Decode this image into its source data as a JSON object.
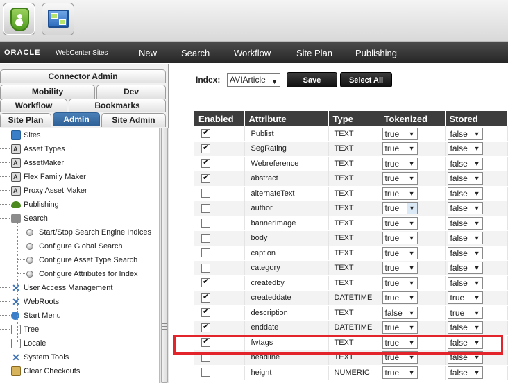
{
  "nav": {
    "logo": "ORACLE",
    "product": "WebCenter Sites",
    "items": [
      "New",
      "Search",
      "Workflow",
      "Site Plan",
      "Publishing"
    ]
  },
  "tabs": {
    "connector_admin": "Connector Admin",
    "mobility": "Mobility",
    "dev": "Dev",
    "workflow": "Workflow",
    "bookmarks": "Bookmarks",
    "site_plan": "Site Plan",
    "admin": "Admin",
    "site_admin": "Site Admin"
  },
  "tree": [
    {
      "label": "Sites",
      "icon": "sites-icon"
    },
    {
      "label": "Asset Types",
      "icon": "asset-icon"
    },
    {
      "label": "AssetMaker",
      "icon": "asset-icon"
    },
    {
      "label": "Flex Family Maker",
      "icon": "asset-icon"
    },
    {
      "label": "Proxy Asset Maker",
      "icon": "asset-icon"
    },
    {
      "label": "Publishing",
      "icon": "publishing-icon"
    },
    {
      "label": "Search",
      "icon": "search-folder-icon"
    },
    {
      "label": "Start/Stop Search Engine Indices",
      "icon": "bullet-icon"
    },
    {
      "label": "Configure Global Search",
      "icon": "bullet-icon"
    },
    {
      "label": "Configure Asset Type Search",
      "icon": "bullet-icon"
    },
    {
      "label": "Configure Attributes for Index",
      "icon": "bullet-icon"
    },
    {
      "label": "User Access Management",
      "icon": "tools-icon"
    },
    {
      "label": "WebRoots",
      "icon": "tools-icon"
    },
    {
      "label": "Start Menu",
      "icon": "start-menu-icon"
    },
    {
      "label": "Tree",
      "icon": "page-icon"
    },
    {
      "label": "Locale",
      "icon": "page-icon"
    },
    {
      "label": "System Tools",
      "icon": "tools-icon"
    },
    {
      "label": "Clear Checkouts",
      "icon": "clear-icon"
    }
  ],
  "form": {
    "index_label": "Index:",
    "index_value": "AVIArticle",
    "save_label": "Save",
    "select_all_label": "Select All"
  },
  "table": {
    "headers": [
      "Enabled",
      "Attribute",
      "Type",
      "Tokenized",
      "Stored"
    ],
    "rows": [
      {
        "enabled": true,
        "attribute": "Publist",
        "type": "TEXT",
        "tokenized": "true",
        "stored": "false"
      },
      {
        "enabled": true,
        "attribute": "SegRating",
        "type": "TEXT",
        "tokenized": "true",
        "stored": "false"
      },
      {
        "enabled": true,
        "attribute": "Webreference",
        "type": "TEXT",
        "tokenized": "true",
        "stored": "false"
      },
      {
        "enabled": true,
        "attribute": "abstract",
        "type": "TEXT",
        "tokenized": "true",
        "stored": "false"
      },
      {
        "enabled": false,
        "attribute": "alternateText",
        "type": "TEXT",
        "tokenized": "true",
        "stored": "false"
      },
      {
        "enabled": false,
        "attribute": "author",
        "type": "TEXT",
        "tokenized": "true",
        "stored": "false"
      },
      {
        "enabled": false,
        "attribute": "bannerImage",
        "type": "TEXT",
        "tokenized": "true",
        "stored": "false"
      },
      {
        "enabled": false,
        "attribute": "body",
        "type": "TEXT",
        "tokenized": "true",
        "stored": "false"
      },
      {
        "enabled": false,
        "attribute": "caption",
        "type": "TEXT",
        "tokenized": "true",
        "stored": "false"
      },
      {
        "enabled": false,
        "attribute": "category",
        "type": "TEXT",
        "tokenized": "true",
        "stored": "false"
      },
      {
        "enabled": true,
        "attribute": "createdby",
        "type": "TEXT",
        "tokenized": "true",
        "stored": "false"
      },
      {
        "enabled": true,
        "attribute": "createddate",
        "type": "DATETIME",
        "tokenized": "true",
        "stored": "true"
      },
      {
        "enabled": true,
        "attribute": "description",
        "type": "TEXT",
        "tokenized": "false",
        "stored": "true"
      },
      {
        "enabled": true,
        "attribute": "enddate",
        "type": "DATETIME",
        "tokenized": "true",
        "stored": "false"
      },
      {
        "enabled": true,
        "attribute": "fwtags",
        "type": "TEXT",
        "tokenized": "true",
        "stored": "false"
      },
      {
        "enabled": false,
        "attribute": "headline",
        "type": "TEXT",
        "tokenized": "true",
        "stored": "false"
      },
      {
        "enabled": false,
        "attribute": "height",
        "type": "NUMERIC",
        "tokenized": "true",
        "stored": "false"
      }
    ],
    "highlighted_attribute": "fwtags",
    "focused_tokenized_attribute": "author"
  },
  "colors": {
    "nav_bg": "#262626",
    "active_tab": "#2d5f95",
    "table_header": "#3d3d3d",
    "highlight": "#e3242b"
  }
}
